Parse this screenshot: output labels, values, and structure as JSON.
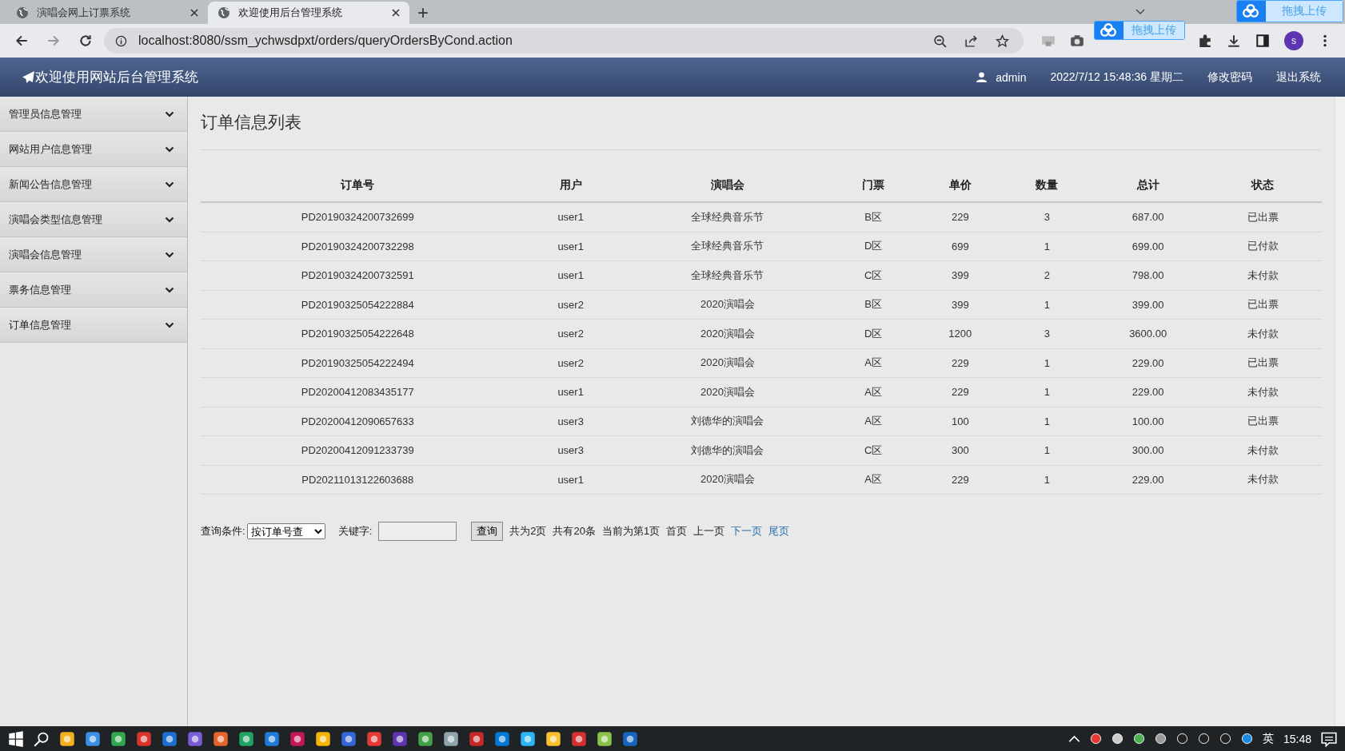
{
  "browser": {
    "tabs": [
      {
        "title": "演唱会网上订票系统",
        "selected": false
      },
      {
        "title": "欢迎使用后台管理系统",
        "selected": true
      }
    ],
    "new_tab": "+",
    "url": "localhost:8080/ssm_ychwsdpxt/orders/queryOrdersByCond.action",
    "profile": "s",
    "upload_buttons": [
      "拖拽上传",
      "拖拽上传"
    ]
  },
  "header": {
    "title": "欢迎使用网站后台管理系统",
    "user": "admin",
    "datetime": "2022/7/12 15:48:36 星期二",
    "links": [
      "修改密码",
      "退出系统"
    ]
  },
  "sidebar": {
    "items": [
      "管理员信息管理",
      "网站用户信息管理",
      "新闻公告信息管理",
      "演唱会类型信息管理",
      "演唱会信息管理",
      "票务信息管理",
      "订单信息管理"
    ]
  },
  "page_title": "订单信息列表",
  "table": {
    "columns": [
      "订单号",
      "用户",
      "演唱会",
      "门票",
      "单价",
      "数量",
      "总计",
      "状态"
    ],
    "rows": [
      [
        "PD20190324200732699",
        "user1",
        "全球经典音乐节",
        "B区",
        "229",
        "3",
        "687.00",
        "已出票"
      ],
      [
        "PD20190324200732298",
        "user1",
        "全球经典音乐节",
        "D区",
        "699",
        "1",
        "699.00",
        "已付款"
      ],
      [
        "PD20190324200732591",
        "user1",
        "全球经典音乐节",
        "C区",
        "399",
        "2",
        "798.00",
        "未付款"
      ],
      [
        "PD20190325054222884",
        "user2",
        "2020演唱会",
        "B区",
        "399",
        "1",
        "399.00",
        "已出票"
      ],
      [
        "PD20190325054222648",
        "user2",
        "2020演唱会",
        "D区",
        "1200",
        "3",
        "3600.00",
        "未付款"
      ],
      [
        "PD20190325054222494",
        "user2",
        "2020演唱会",
        "A区",
        "229",
        "1",
        "229.00",
        "已出票"
      ],
      [
        "PD20200412083435177",
        "user1",
        "2020演唱会",
        "A区",
        "229",
        "1",
        "229.00",
        "未付款"
      ],
      [
        "PD20200412090657633",
        "user3",
        "刘德华的演唱会",
        "A区",
        "100",
        "1",
        "100.00",
        "已出票"
      ],
      [
        "PD20200412091233739",
        "user3",
        "刘德华的演唱会",
        "C区",
        "300",
        "1",
        "300.00",
        "未付款"
      ],
      [
        "PD20211013122603688",
        "user1",
        "2020演唱会",
        "A区",
        "229",
        "1",
        "229.00",
        "未付款"
      ]
    ]
  },
  "query": {
    "label": "查询条件:",
    "select": "按订单号查",
    "keyword_label": "关键字:",
    "button": "查询",
    "info": [
      "共为2页",
      "共有20条",
      "当前为第1页"
    ],
    "pager": [
      {
        "label": "首页",
        "enabled": false
      },
      {
        "label": "上一页",
        "enabled": false
      },
      {
        "label": "下一页",
        "enabled": true
      },
      {
        "label": "尾页",
        "enabled": true
      }
    ]
  },
  "taskbar": {
    "ime": "英",
    "time": "15:48"
  }
}
